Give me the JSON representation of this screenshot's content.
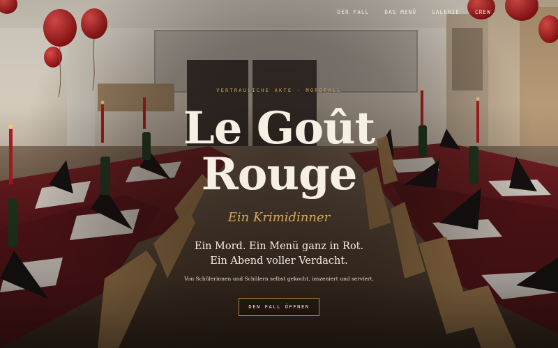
{
  "nav": {
    "items": [
      {
        "label": "DER FALL"
      },
      {
        "label": "DAS MENÜ"
      },
      {
        "label": "GALERIE"
      },
      {
        "label": "CREW"
      }
    ]
  },
  "hero": {
    "eyebrow": "VERTRAULICHE AKTE · MORDFALL",
    "title_line1": "Le Goût",
    "title_line2": "Rouge",
    "subtitle": "Ein Krimidinner",
    "tagline_line1": "Ein Mord. Ein Menü ganz in Rot.",
    "tagline_line2": "Ein Abend voller Verdacht.",
    "description": "Von Schülerinnen und Schülern selbst gekocht, inszeniert und serviert.",
    "cta_label": "DEN FALL ÖFFNEN"
  },
  "colors": {
    "accent_gold": "#c9a25c",
    "title_cream": "#f6efe4",
    "cta_border": "#b7824a",
    "tablecloth_red": "#6e1a1e"
  }
}
